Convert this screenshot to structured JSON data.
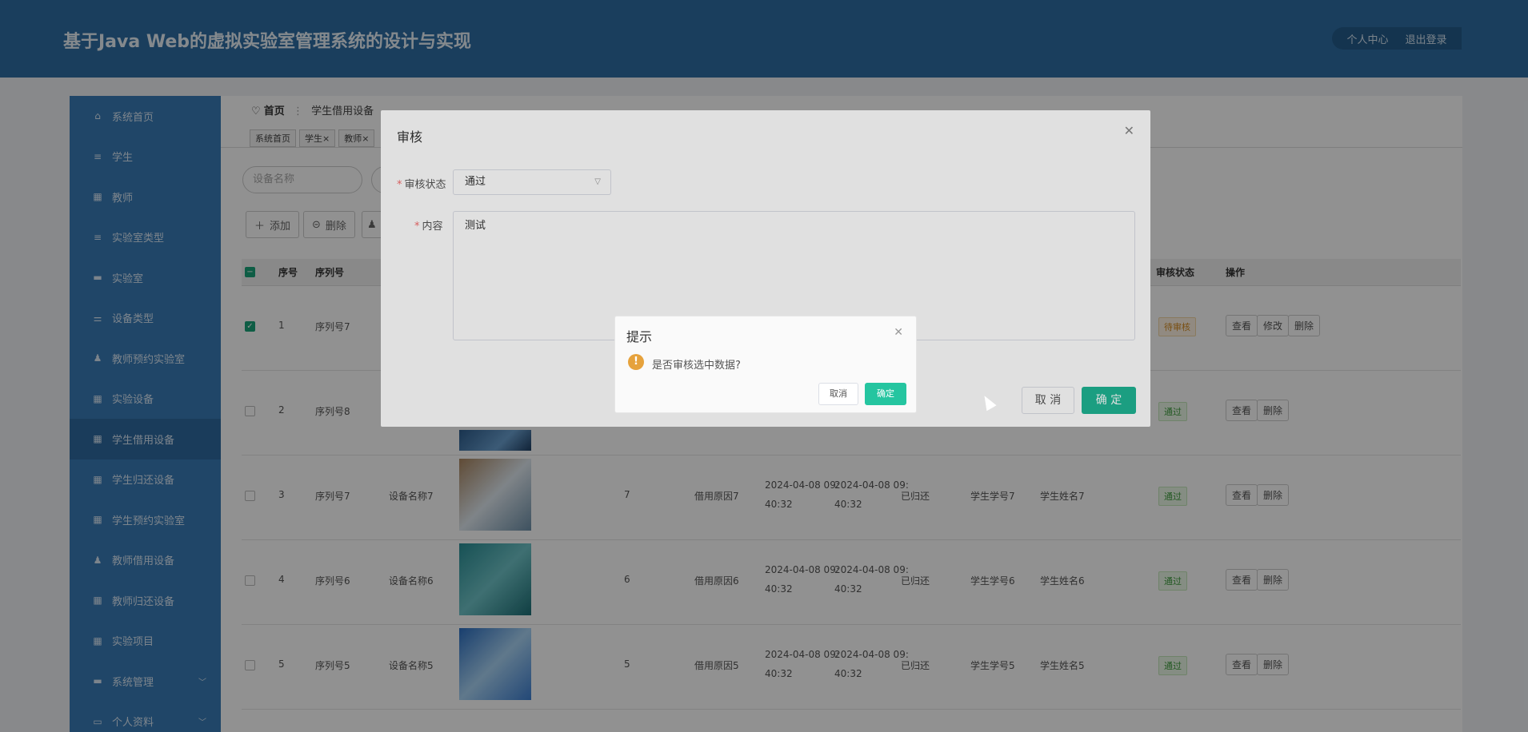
{
  "header": {
    "title": "基于Java Web的虚拟实验室管理系统的设计与实现",
    "personal": "个人中心",
    "logout": "退出登录"
  },
  "sidebar": {
    "items": [
      {
        "label": "系统首页",
        "icon": "home-icon"
      },
      {
        "label": "学生",
        "icon": "list-icon"
      },
      {
        "label": "教师",
        "icon": "grid-icon"
      },
      {
        "label": "实验室类型",
        "icon": "list-icon"
      },
      {
        "label": "实验室",
        "icon": "monitor-icon"
      },
      {
        "label": "设备类型",
        "icon": "sliders-icon"
      },
      {
        "label": "教师预约实验室",
        "icon": "user-icon"
      },
      {
        "label": "实验设备",
        "icon": "grid-icon"
      },
      {
        "label": "学生借用设备",
        "icon": "grid-icon",
        "active": true
      },
      {
        "label": "学生归还设备",
        "icon": "grid-icon"
      },
      {
        "label": "学生预约实验室",
        "icon": "grid-icon"
      },
      {
        "label": "教师借用设备",
        "icon": "user-icon"
      },
      {
        "label": "教师归还设备",
        "icon": "grid-icon"
      },
      {
        "label": "实验项目",
        "icon": "grid-icon"
      },
      {
        "label": "系统管理",
        "icon": "monitor-icon",
        "chevron": true
      },
      {
        "label": "个人资料",
        "icon": "card-icon",
        "chevron": true
      }
    ]
  },
  "breadcrumb": {
    "home": "首页",
    "current": "学生借用设备"
  },
  "tags": [
    "系统首页",
    "学生×",
    "教师×"
  ],
  "search": {
    "placeholder": "设备名称"
  },
  "toolbar": {
    "add": "添加",
    "delete": "删除"
  },
  "table": {
    "headers": {
      "index": "序号",
      "serial": "序列号",
      "audit": "审核状态",
      "ops": "操作"
    },
    "rows": [
      {
        "idx": "1",
        "serial": "序列号7",
        "name": "",
        "qty": "",
        "reason": "",
        "t1a": "",
        "t1b": "",
        "t2a": "",
        "t2b": "",
        "ret": "",
        "sno": "",
        "sname": "",
        "status": "待审核",
        "ops": [
          "查看",
          "修改",
          "删除"
        ],
        "checked": true
      },
      {
        "idx": "2",
        "serial": "序列号8",
        "name": "",
        "qty": "",
        "reason": "",
        "t1a": "",
        "t1b": "",
        "t2a": "",
        "t2b": "",
        "ret": "",
        "sno": "",
        "sname": "",
        "status": "通过",
        "ops": [
          "查看",
          "删除"
        ]
      },
      {
        "idx": "3",
        "serial": "序列号7",
        "name": "设备名称7",
        "qty": "7",
        "reason": "借用原因7",
        "t1a": "2024-04-08 09:",
        "t1b": "40:32",
        "t2a": "2024-04-08 09:",
        "t2b": "40:32",
        "ret": "已归还",
        "sno": "学生学号7",
        "sname": "学生姓名7",
        "status": "通过",
        "ops": [
          "查看",
          "删除"
        ]
      },
      {
        "idx": "4",
        "serial": "序列号6",
        "name": "设备名称6",
        "qty": "6",
        "reason": "借用原因6",
        "t1a": "2024-04-08 09:",
        "t1b": "40:32",
        "t2a": "2024-04-08 09:",
        "t2b": "40:32",
        "ret": "已归还",
        "sno": "学生学号6",
        "sname": "学生姓名6",
        "status": "通过",
        "ops": [
          "查看",
          "删除"
        ]
      },
      {
        "idx": "5",
        "serial": "序列号5",
        "name": "设备名称5",
        "qty": "5",
        "reason": "借用原因5",
        "t1a": "2024-04-08 09:",
        "t1b": "40:32",
        "t2a": "2024-04-08 09:",
        "t2b": "40:32",
        "ret": "已归还",
        "sno": "学生学号5",
        "sname": "学生姓名5",
        "status": "通过",
        "ops": [
          "查看",
          "删除"
        ]
      }
    ]
  },
  "audit_dialog": {
    "title": "审核",
    "status_label": "审核状态",
    "status_value": "通过",
    "content_label": "内容",
    "content_value": "测试",
    "cancel": "取 消",
    "confirm": "确 定"
  },
  "confirm_box": {
    "title": "提示",
    "message": "是否审核选中数据?",
    "cancel": "取消",
    "confirm": "确定"
  },
  "colors": {
    "header": "#2f6ea4",
    "sidebar": "#3a7cb7",
    "primary": "#1fb493",
    "warning": "#e6a23c"
  }
}
